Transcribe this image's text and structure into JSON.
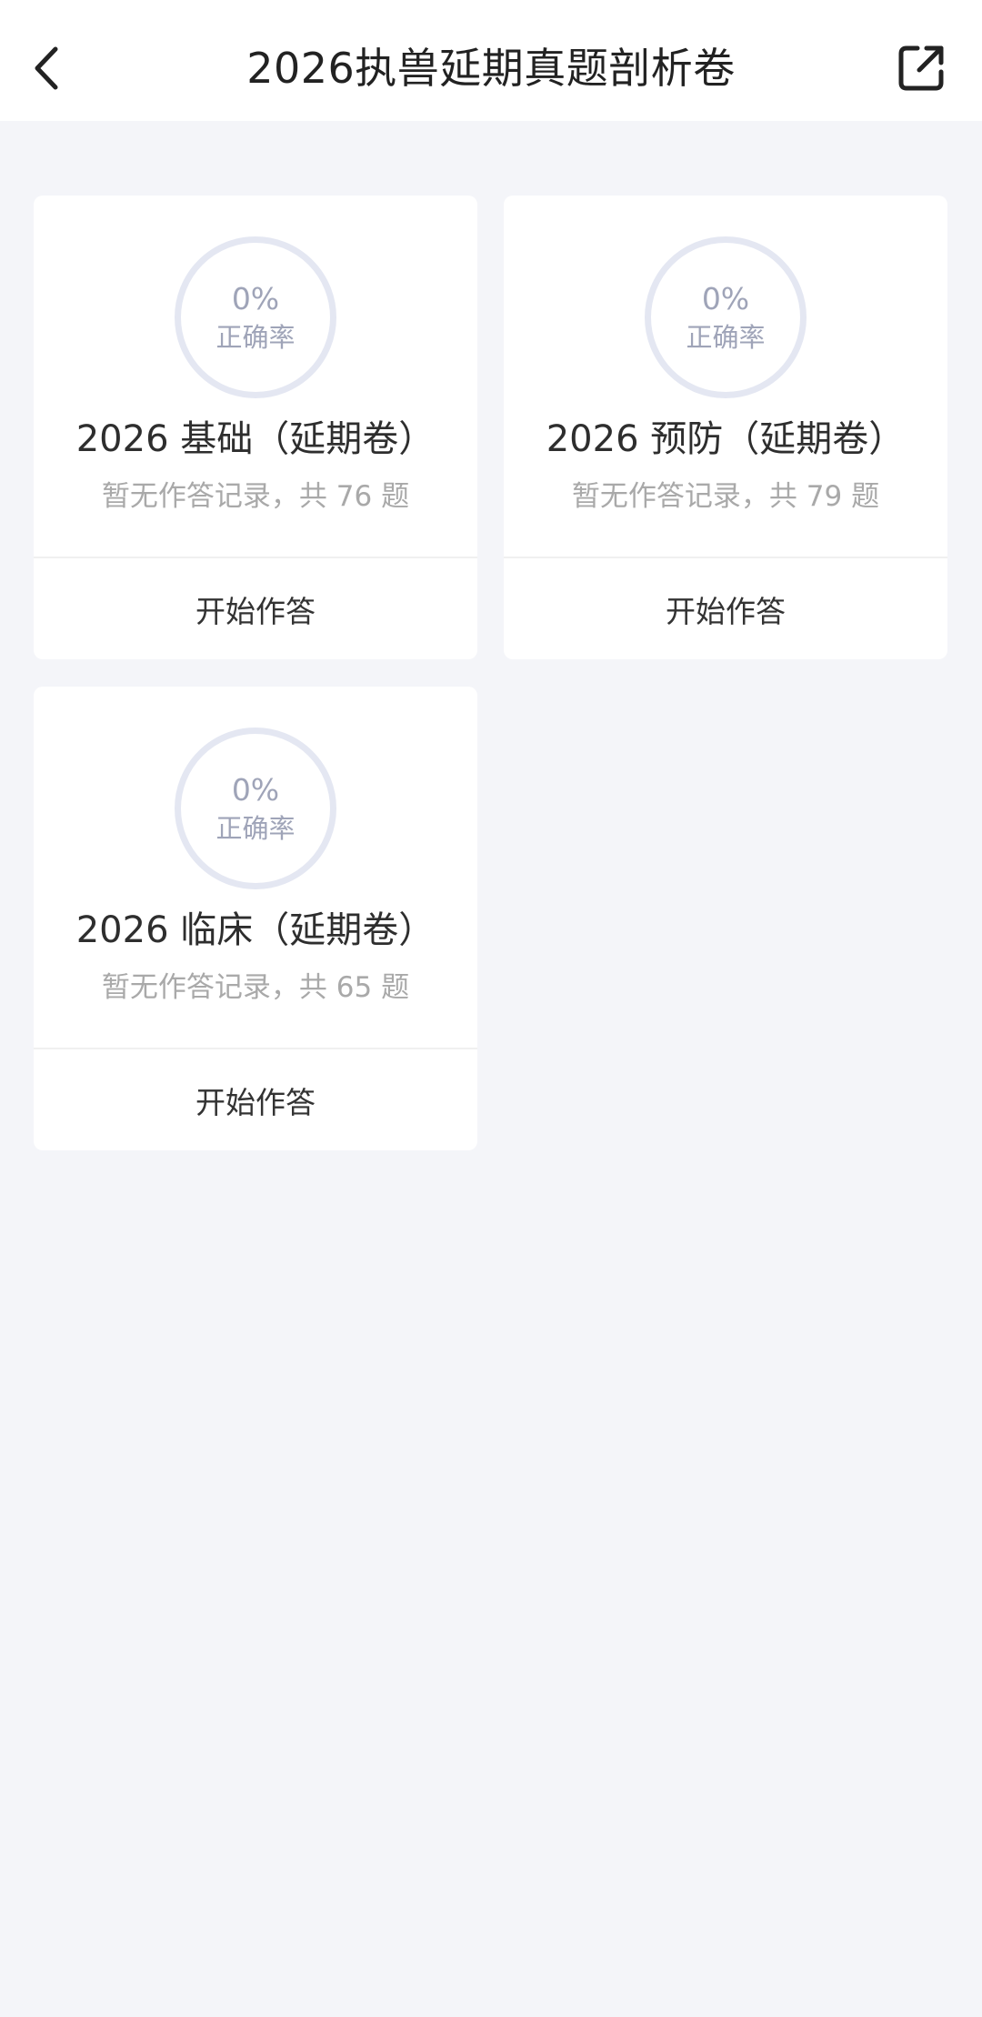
{
  "header": {
    "title": "2026执兽延期真题剖析卷",
    "back_icon": "chevron-left-icon",
    "share_icon": "share-external-icon"
  },
  "cards": [
    {
      "percent": "0%",
      "accuracy_label": "正确率",
      "title": "2026 基础（延期卷）",
      "subtitle": "暂无作答记录，共 76 题",
      "action_label": "开始作答"
    },
    {
      "percent": "0%",
      "accuracy_label": "正确率",
      "title": "2026 预防（延期卷）",
      "subtitle": "暂无作答记录，共 79 题",
      "action_label": "开始作答"
    },
    {
      "percent": "0%",
      "accuracy_label": "正确率",
      "title": "2026 临床（延期卷）",
      "subtitle": "暂无作答记录，共 65 题",
      "action_label": "开始作答"
    }
  ],
  "colors": {
    "background": "#f4f5f9",
    "card": "#ffffff",
    "ring": "#e4e7f2",
    "ring_text": "#9fa4b8",
    "subtitle": "#a9a9a9"
  }
}
